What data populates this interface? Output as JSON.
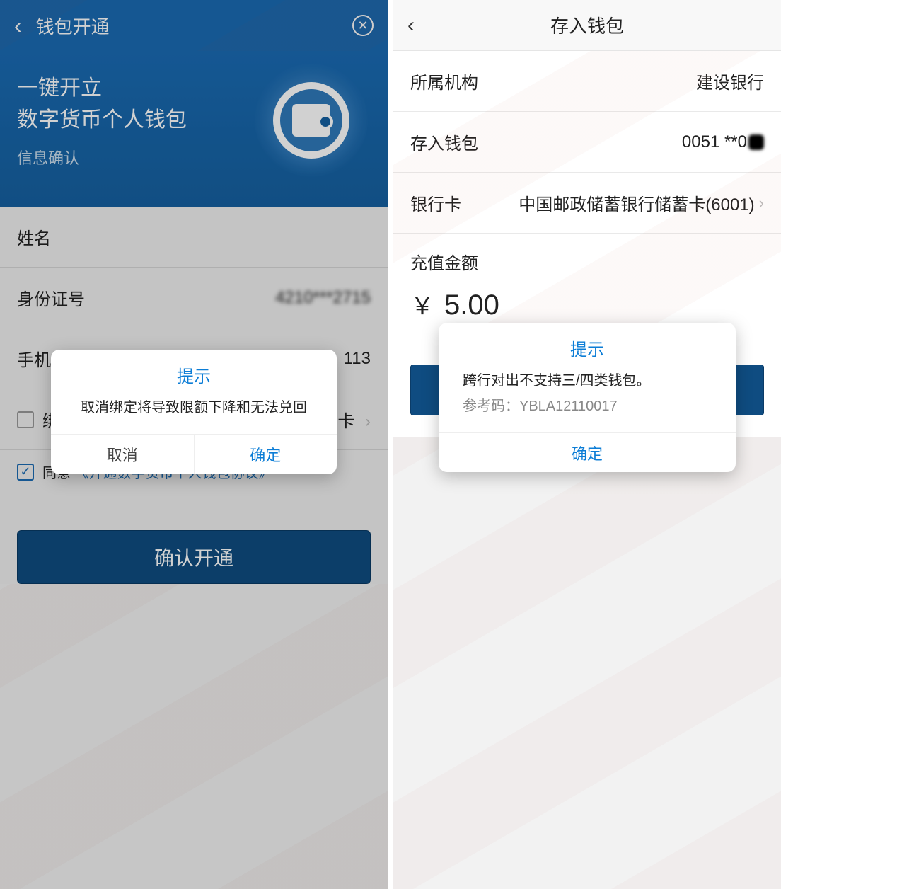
{
  "left": {
    "header": {
      "title": "钱包开通"
    },
    "hero": {
      "line1": "一键开立",
      "line2": "数字货币个人钱包",
      "sub": "信息确认"
    },
    "form": {
      "name_label": "姓名",
      "id_label": "身份证号",
      "id_value": "4210***2715",
      "phone_label": "手机",
      "phone_value_suffix": "113",
      "bind_label": "绑",
      "bind_value_suffix": "卡",
      "agree_label": "同意",
      "agree_link": "《开通数字货币个人钱包协议》",
      "submit": "确认开通"
    },
    "dialog": {
      "title": "提示",
      "body": "取消绑定将导致限额下降和无法兑回",
      "cancel": "取消",
      "ok": "确定"
    }
  },
  "right": {
    "header": {
      "title": "存入钱包"
    },
    "rows": {
      "org_label": "所属机构",
      "org_value": "建设银行",
      "wallet_label": "存入钱包",
      "wallet_value": "0051 **0",
      "card_label": "银行卡",
      "card_value": "中国邮政储蓄银行储蓄卡(6001)"
    },
    "amount": {
      "label": "充值金额",
      "symbol": "￥",
      "value": "5.00"
    },
    "dialog": {
      "title": "提示",
      "body": "跨行对出不支持三/四类钱包。",
      "ref_label": "参考码：",
      "ref_code": "YBLA12110017",
      "ok": "确定"
    }
  }
}
